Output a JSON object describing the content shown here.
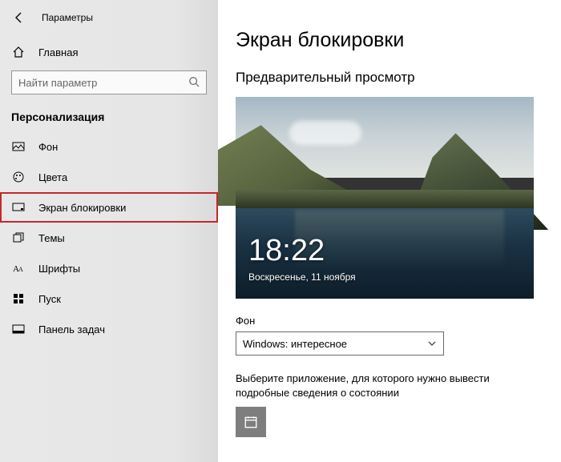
{
  "window_title": "Параметры",
  "home_label": "Главная",
  "search_placeholder": "Найти параметр",
  "section": "Персонализация",
  "nav": [
    {
      "label": "Фон"
    },
    {
      "label": "Цвета"
    },
    {
      "label": "Экран блокировки"
    },
    {
      "label": "Темы"
    },
    {
      "label": "Шрифты"
    },
    {
      "label": "Пуск"
    },
    {
      "label": "Панель задач"
    }
  ],
  "main": {
    "title": "Экран блокировки",
    "preview_heading": "Предварительный просмотр",
    "preview_time": "18:22",
    "preview_date": "Воскресенье, 11 ноября",
    "bg_field_label": "Фон",
    "bg_selected": "Windows: интересное",
    "choose_app_label": "Выберите приложение, для которого нужно вывести подробные сведения о состоянии"
  }
}
